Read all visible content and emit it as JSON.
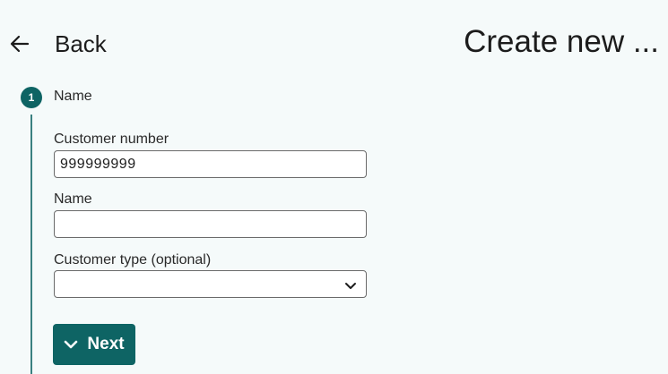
{
  "header": {
    "back_label": "Back",
    "back_icon": "arrow-left-icon",
    "title": "Create new ..."
  },
  "stepper": {
    "step_number": "1",
    "step_title": "Name",
    "accent_color": "#0e6464"
  },
  "form": {
    "customer_number": {
      "label": "Customer number",
      "value": "999999999"
    },
    "name": {
      "label": "Name",
      "value": ""
    },
    "customer_type": {
      "label": "Customer type (optional)",
      "selected": "",
      "icon": "chevron-down-icon"
    },
    "next_button": {
      "label": "Next",
      "icon": "chevron-down-icon"
    }
  }
}
